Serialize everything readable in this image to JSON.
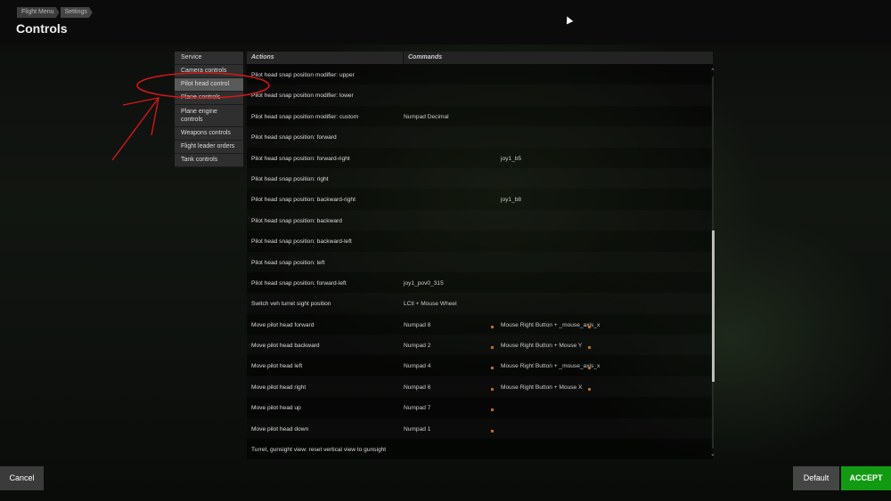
{
  "breadcrumb": [
    "Flight Menu",
    "Settings"
  ],
  "page_title": "Controls",
  "sidebar": {
    "items": [
      {
        "label": "Service",
        "active": false
      },
      {
        "label": "Camera controls",
        "active": false
      },
      {
        "label": "Pilot head control",
        "active": true
      },
      {
        "label": "Plane controls",
        "active": false
      },
      {
        "label": "Plane engine controls",
        "active": false
      },
      {
        "label": "Weapons controls",
        "active": false
      },
      {
        "label": "Flight leader orders",
        "active": false
      },
      {
        "label": "Tank controls",
        "active": false
      }
    ]
  },
  "table": {
    "headers": {
      "actions": "Actions",
      "commands": "Commands"
    },
    "rows": [
      {
        "action": "Pilot head snap position modifier: upper",
        "cmd1": "",
        "cmd2": ""
      },
      {
        "action": "Pilot head snap position modifier: lower",
        "cmd1": "",
        "cmd2": ""
      },
      {
        "action": "Pilot head snap position modifier: custom",
        "cmd1": "Numpad Decimal",
        "cmd2": ""
      },
      {
        "action": "Pilot head snap position: forward",
        "cmd1": "",
        "cmd2": ""
      },
      {
        "action": "Pilot head snap position: forward-right",
        "cmd1": "",
        "cmd2": "joy1_b5"
      },
      {
        "action": "Pilot head snap position: right",
        "cmd1": "",
        "cmd2": ""
      },
      {
        "action": "Pilot head snap position: backward-right",
        "cmd1": "",
        "cmd2": "joy1_b8"
      },
      {
        "action": "Pilot head snap position: backward",
        "cmd1": "",
        "cmd2": ""
      },
      {
        "action": "Pilot head snap position: backward-left",
        "cmd1": "",
        "cmd2": ""
      },
      {
        "action": "Pilot head snap position: left",
        "cmd1": "",
        "cmd2": ""
      },
      {
        "action": "Pilot head snap position: forward-left",
        "cmd1": "joy1_pov0_315",
        "cmd2": ""
      },
      {
        "action": "Switch veh turret sight position",
        "cmd1": "LCtl + Mouse Wheel",
        "cmd2": ""
      },
      {
        "action": "Move pilot head forward",
        "cmd1": "Numpad 8",
        "cmd2": "Mouse Right Button + _mouse_axis_x"
      },
      {
        "action": "Move pilot head backward",
        "cmd1": "Numpad 2",
        "cmd2": "Mouse Right Button + Mouse Y"
      },
      {
        "action": "Move pilot head left",
        "cmd1": "Numpad 4",
        "cmd2": "Mouse Right Button + _mouse_axis_x"
      },
      {
        "action": "Move pilot head right",
        "cmd1": "Numpad 6",
        "cmd2": "Mouse Right Button + Mouse X"
      },
      {
        "action": "Move pilot head up",
        "cmd1": "Numpad 7",
        "cmd2": ""
      },
      {
        "action": "Move pilot head down",
        "cmd1": "Numpad 1",
        "cmd2": ""
      },
      {
        "action": "Turret, gunsight view: reset vertical view to gunsight",
        "cmd1": "",
        "cmd2": ""
      }
    ]
  },
  "buttons": {
    "cancel": "Cancel",
    "default": "Default",
    "accept": "ACCEPT"
  },
  "icons": {
    "scroll_up": "chevron-up-icon",
    "scroll_down": "chevron-down-icon",
    "modified_marker": "orange-square-icon"
  },
  "colors": {
    "accept": "#129b12",
    "annotation": "#d01818",
    "marker": "#c26a1a"
  }
}
